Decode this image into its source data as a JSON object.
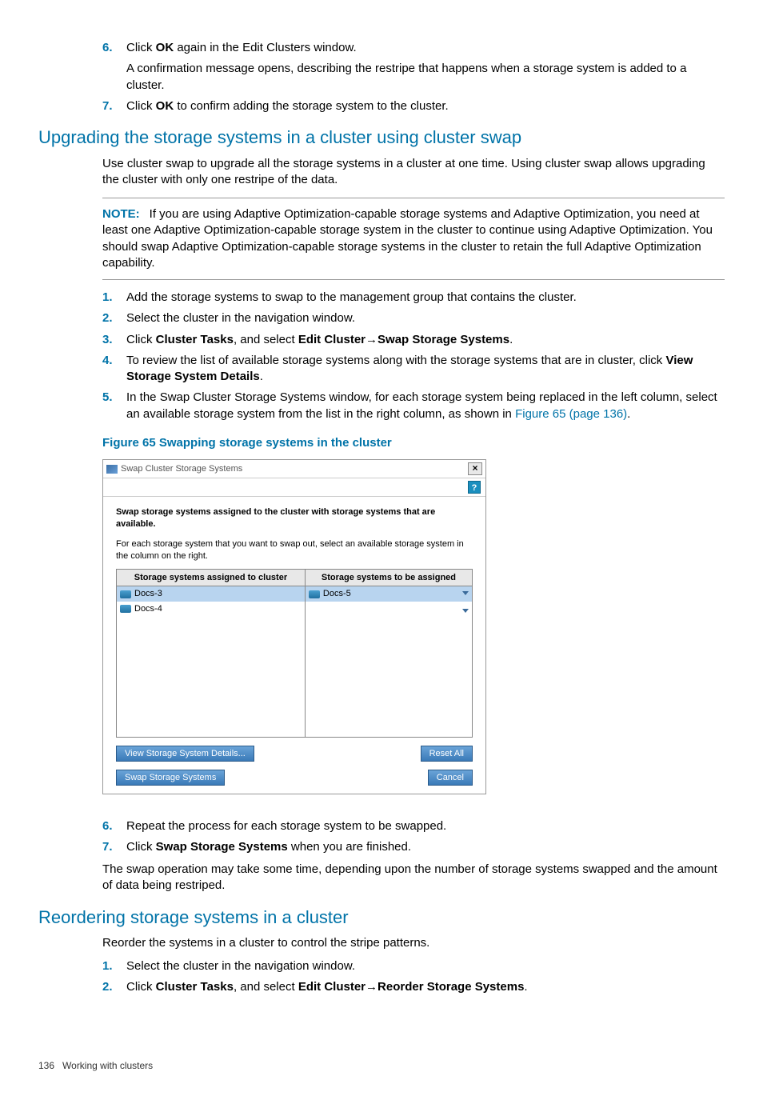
{
  "top": {
    "step6_num": "6.",
    "step6_text_a": "Click ",
    "step6_text_b": "OK",
    "step6_text_c": " again in the Edit Clusters window.",
    "step6_sub": "A confirmation message opens, describing the restripe that happens when a storage system is added to a cluster.",
    "step7_num": "7.",
    "step7_text_a": "Click ",
    "step7_text_b": "OK",
    "step7_text_c": " to confirm adding the storage system to the cluster."
  },
  "upgrade": {
    "heading": "Upgrading the storage systems in a cluster using cluster swap",
    "intro": "Use cluster swap to upgrade all the storage systems in a cluster at one time. Using cluster swap allows upgrading the cluster with only one restripe of the data.",
    "note_label": "NOTE:",
    "note_text": "If you are using Adaptive Optimization-capable storage systems and Adaptive Optimization, you need at least one Adaptive Optimization-capable storage system in the cluster to continue using Adaptive Optimization. You should swap Adaptive Optimization-capable storage systems in the cluster to retain the full Adaptive Optimization capability.",
    "s1_num": "1.",
    "s1_text": "Add the storage systems to swap to the management group that contains the cluster.",
    "s2_num": "2.",
    "s2_text": "Select the cluster in the navigation window.",
    "s3_num": "3.",
    "s3_a": "Click ",
    "s3_b": "Cluster Tasks",
    "s3_c": ", and select ",
    "s3_d": "Edit Cluster",
    "s3_arrow": "→",
    "s3_e": "Swap Storage Systems",
    "s3_f": ".",
    "s4_num": "4.",
    "s4_a": "To review the list of available storage systems along with the storage systems that are in cluster, click ",
    "s4_b": "View Storage System Details",
    "s4_c": ".",
    "s5_num": "5.",
    "s5_a": "In the Swap Cluster Storage Systems window, for each storage system being replaced in the left column, select an available storage system from the list in the right column, as shown in ",
    "s5_link": "Figure 65 (page 136)",
    "s5_b": ".",
    "fig_caption": "Figure 65 Swapping storage systems in the cluster",
    "s6_num": "6.",
    "s6_text": "Repeat the process for each storage system to be swapped.",
    "s7_num": "7.",
    "s7_a": "Click ",
    "s7_b": "Swap Storage Systems",
    "s7_c": " when you are finished.",
    "outro": "The swap operation may take some time, depending upon the number of storage systems swapped and the amount of data being restriped."
  },
  "dialog": {
    "title": "Swap Cluster Storage Systems",
    "close": "×",
    "help": "?",
    "instr1": "Swap storage systems assigned to the cluster with storage systems that are available.",
    "instr2": "For each storage system that you want to swap out, select an available storage system in the column on the right.",
    "col1": "Storage systems assigned to cluster",
    "col2": "Storage systems to be assigned",
    "row1_left": "Docs-3",
    "row1_right": "Docs-5",
    "row2_left": "Docs-4",
    "btn_view": "View Storage System Details...",
    "btn_reset": "Reset All",
    "btn_swap": "Swap Storage Systems",
    "btn_cancel": "Cancel"
  },
  "reorder": {
    "heading": "Reordering storage systems in a cluster",
    "intro": "Reorder the systems in a cluster to control the stripe patterns.",
    "s1_num": "1.",
    "s1_text": "Select the cluster in the navigation window.",
    "s2_num": "2.",
    "s2_a": "Click ",
    "s2_b": "Cluster Tasks",
    "s2_c": ", and select ",
    "s2_d": "Edit Cluster",
    "s2_arrow": "→",
    "s2_e": "Reorder Storage Systems",
    "s2_f": "."
  },
  "footer": {
    "page": "136",
    "chapter": "Working with clusters"
  }
}
